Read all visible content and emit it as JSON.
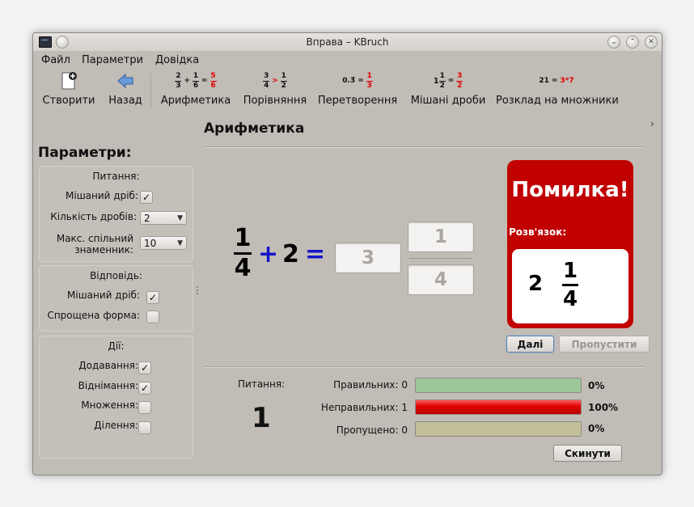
{
  "window": {
    "title": "Вправа – KBruch"
  },
  "menu": [
    "Файл",
    "Параметри",
    "Довідка"
  ],
  "toolbar": {
    "create": "Створити",
    "back": "Назад",
    "arithmetic": "Арифметика",
    "comparison": "Порівняння",
    "conversion": "Перетворення",
    "mixed": "Мішані дроби",
    "factorization": "Розклад на множники",
    "icon_arith": {
      "n1": "2",
      "d1": "3",
      "op": "+",
      "n2": "1",
      "d2": "6",
      "eq": "=",
      "n3": "5",
      "d3": "6"
    },
    "icon_compare": {
      "n1": "3",
      "d1": "4",
      "op": ">",
      "n2": "1",
      "d2": "2"
    },
    "icon_convert": {
      "decimal": "0.3̄",
      "eq": "=",
      "n": "1",
      "d": "3"
    },
    "icon_mixed": {
      "whole": "1",
      "n1": "1",
      "d1": "2",
      "eq": "=",
      "n2": "3",
      "d2": "2"
    },
    "icon_factor": {
      "left": "21",
      "eq": "=",
      "right": "3*7"
    },
    "more": "›"
  },
  "section_title": "Арифметика",
  "params": {
    "title": "Параметри:",
    "task_group": {
      "title": "Питання:",
      "mixed_label": "Мішаний дріб:",
      "mixed_checked": true,
      "count_label": "Кількість дробів:",
      "count_value": "2",
      "denominator_label": "Макс. спільний знаменник:",
      "denominator_value": "10"
    },
    "answer_group": {
      "title": "Відповідь:",
      "mixed_label": "Мішаний дріб:",
      "mixed_checked": true,
      "reduced_label": "Спрощена форма:",
      "reduced_checked": false
    },
    "ops_group": {
      "title": "Дії:",
      "add_label": "Додавання:",
      "add_checked": true,
      "sub_label": "Віднімання:",
      "sub_checked": true,
      "mul_label": "Множення:",
      "mul_checked": false,
      "div_label": "Ділення:",
      "div_checked": false
    }
  },
  "task": {
    "num": "1",
    "den": "4",
    "op": "+",
    "whole": "2",
    "eq": "=",
    "answer_whole": "3",
    "answer_num": "1",
    "answer_den": "4"
  },
  "result": {
    "title": "Помилка!",
    "solution_label": "Розв'язок:",
    "whole": "2",
    "num": "1",
    "den": "4"
  },
  "buttons": {
    "next": "Далі",
    "skip": "Пропустити",
    "reset": "Скинути"
  },
  "stats": {
    "task_label": "Питання:",
    "task_count": "1",
    "correct_label": "Правильних: 0",
    "correct_pct": "0%",
    "correct_fraction": 0,
    "incorrect_label": "Неправильних: 1",
    "incorrect_pct": "100%",
    "incorrect_fraction": 1,
    "skipped_label": "Пропущено: 0",
    "skipped_pct": "0%",
    "skipped_fraction": 0,
    "colors": {
      "correct": "#9dc69b",
      "incorrect": "#e00000",
      "skipped": "#c0bf98"
    }
  }
}
